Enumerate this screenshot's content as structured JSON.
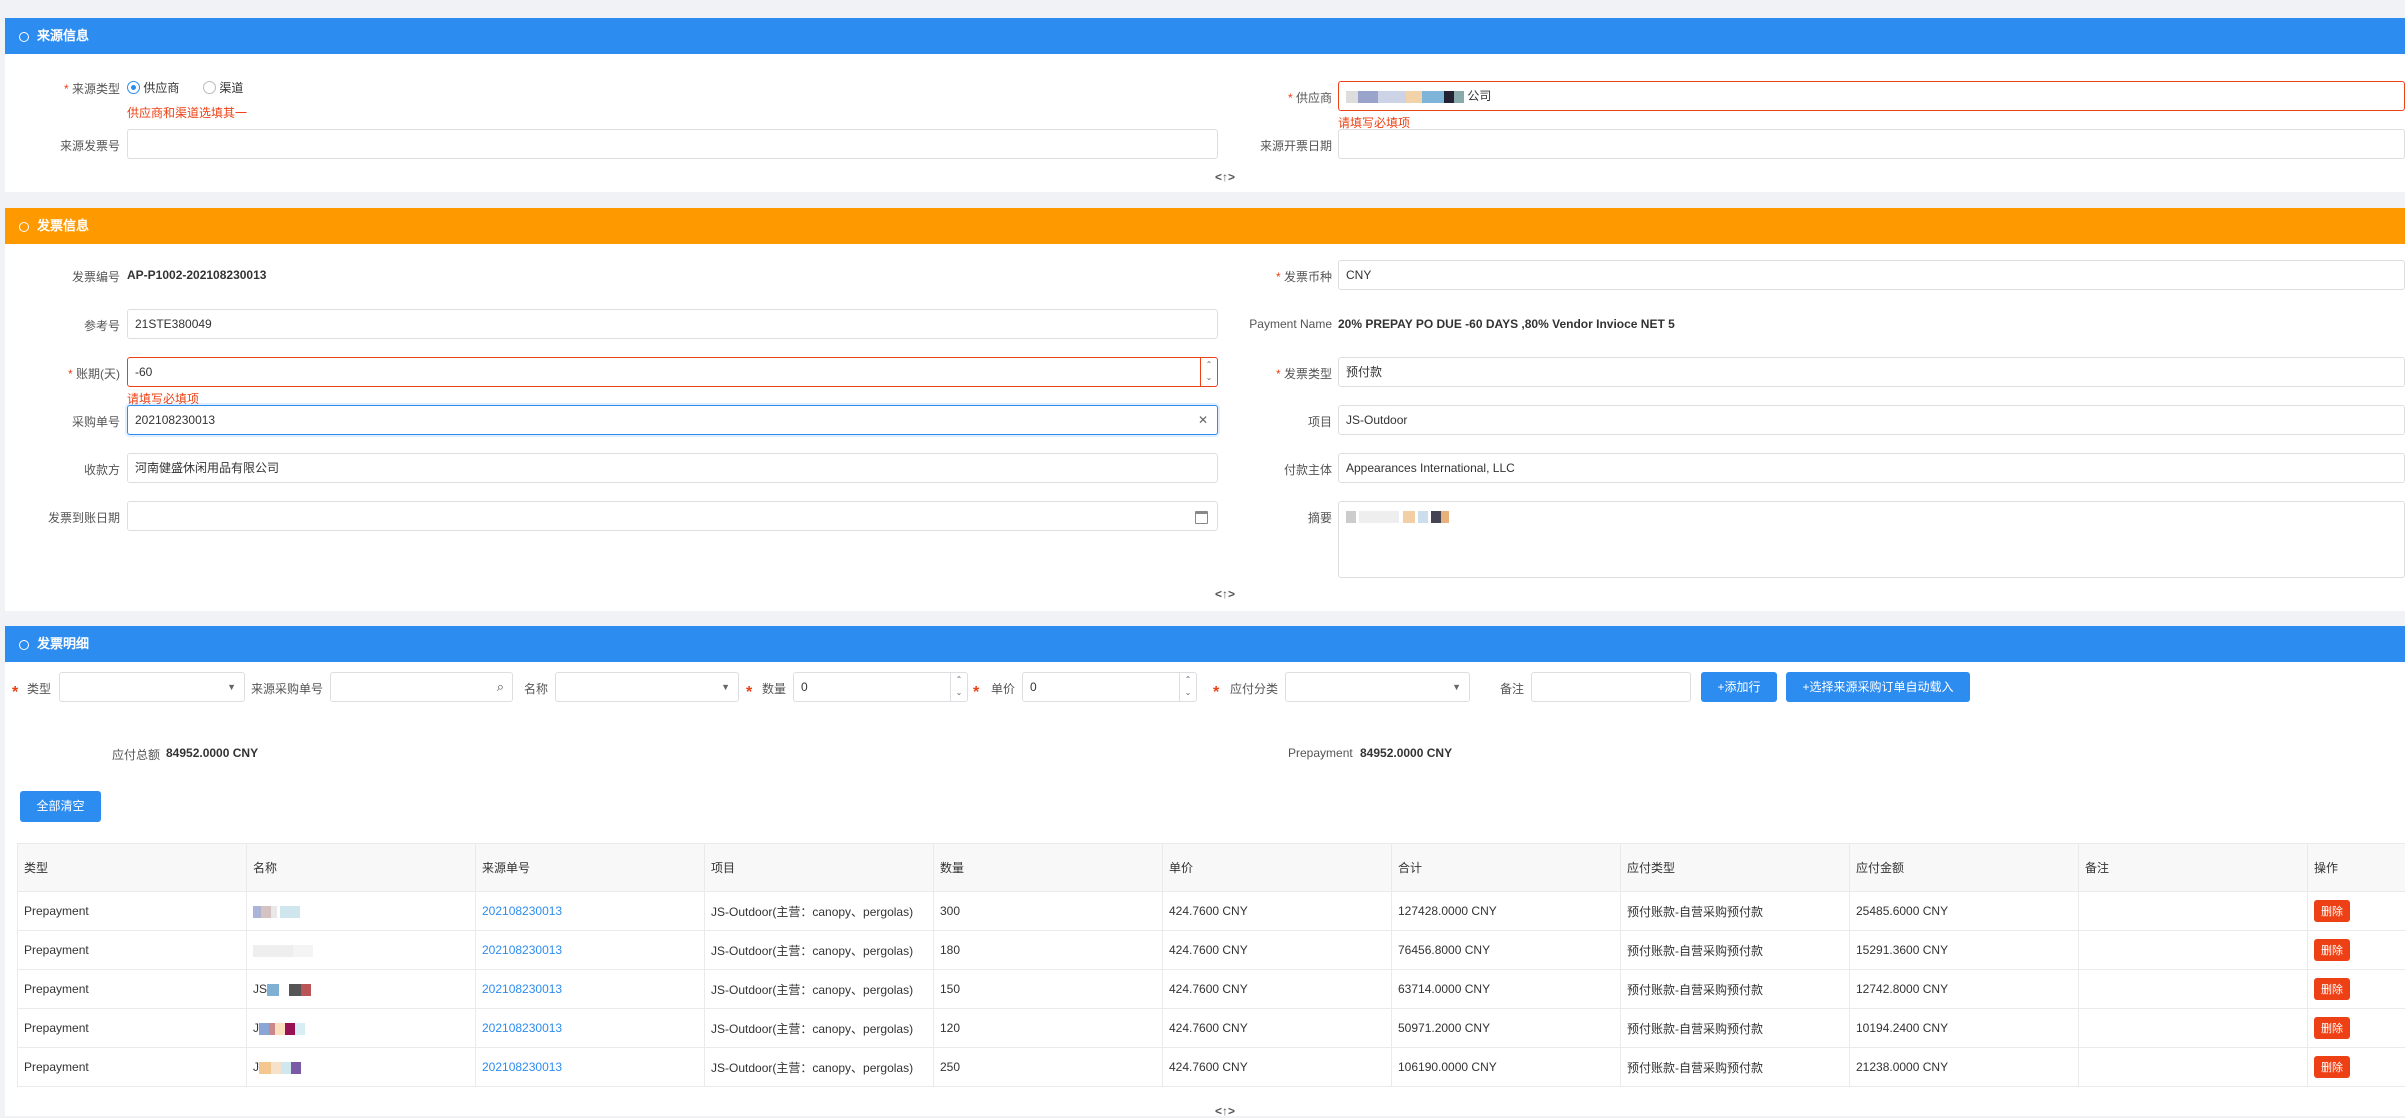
{
  "colors": {
    "primary": "#2d8cf0",
    "warning_bar": "#ff9900",
    "error": "#ed4014"
  },
  "source_section": {
    "title": "来源信息",
    "source_type_label": "来源类型",
    "radio_supplier": "供应商",
    "radio_channel": "渠道",
    "source_type_error": "供应商和渠道选填其一",
    "supplier_label": "供应商",
    "supplier_value_suffix": "公司",
    "supplier_error": "请填写必填项",
    "source_invoice_no_label": "来源发票号",
    "source_invoice_no_value": "",
    "source_invoice_date_label": "来源开票日期",
    "source_invoice_date_value": "",
    "collapse_icon": "collapse-toggle-icon",
    "collapse_text": "<↑>"
  },
  "invoice_section": {
    "title": "发票信息",
    "invoice_no_label": "发票编号",
    "invoice_no_value": "AP-P1002-202108230013",
    "currency_label": "发票币种",
    "currency_value": "CNY",
    "ref_no_label": "参考号",
    "ref_no_value": "21STE380049",
    "payment_name_label": "Payment Name",
    "payment_name_value": "20% PREPAY PO DUE -60 DAYS ,80% Vendor Invioce NET 5",
    "term_days_label": "账期(天)",
    "term_days_value": "-60",
    "term_days_error": "请填写必填项",
    "invoice_type_label": "发票类型",
    "invoice_type_value": "预付款",
    "po_no_label": "采购单号",
    "po_no_value": "202108230013",
    "project_label": "项目",
    "project_value": "JS-Outdoor",
    "payee_label": "收款方",
    "payee_value": "河南健盛休闲用品有限公司",
    "payer_label": "付款主体",
    "payer_value": "Appearances International, LLC",
    "arrival_date_label": "发票到账日期",
    "arrival_date_value": "",
    "summary_label": "摘要",
    "collapse_text": "<↑>"
  },
  "detail_section": {
    "title": "发票明细",
    "type_label": "类型",
    "source_po_label": "来源采购单号",
    "name_label": "名称",
    "qty_label": "数量",
    "qty_value": "0",
    "price_label": "单价",
    "price_value": "0",
    "ap_category_label": "应付分类",
    "remark_label": "备注",
    "add_row_button": "+添加行",
    "auto_load_button": "+选择来源采购订单自动载入",
    "total_label": "应付总额",
    "total_value": "84952.0000 CNY",
    "prepay_label": "Prepayment",
    "prepay_value": "84952.0000 CNY",
    "clear_all_button": "全部清空",
    "collapse_text": "<↑>"
  },
  "table": {
    "columns": [
      "类型",
      "名称",
      "来源单号",
      "项目",
      "数量",
      "单价",
      "合计",
      "应付类型",
      "应付金额",
      "备注",
      "操作"
    ],
    "rows": [
      {
        "type": "Prepayment",
        "name": "",
        "src": "202108230013",
        "project": "JS-Outdoor(主营：canopy、pergolas)",
        "qty": "300",
        "price": "424.7600 CNY",
        "total": "127428.0000 CNY",
        "ap_type": "预付账款-自营采购预付款",
        "amount": "25485.6000 CNY",
        "remark": "",
        "op": "删除"
      },
      {
        "type": "Prepayment",
        "name": "",
        "src": "202108230013",
        "project": "JS-Outdoor(主营：canopy、pergolas)",
        "qty": "180",
        "price": "424.7600 CNY",
        "total": "76456.8000 CNY",
        "ap_type": "预付账款-自营采购预付款",
        "amount": "15291.3600 CNY",
        "remark": "",
        "op": "删除"
      },
      {
        "type": "Prepayment",
        "name": "JS",
        "src": "202108230013",
        "project": "JS-Outdoor(主营：canopy、pergolas)",
        "qty": "150",
        "price": "424.7600 CNY",
        "total": "63714.0000 CNY",
        "ap_type": "预付账款-自营采购预付款",
        "amount": "12742.8000 CNY",
        "remark": "",
        "op": "删除"
      },
      {
        "type": "Prepayment",
        "name": "J",
        "src": "202108230013",
        "project": "JS-Outdoor(主营：canopy、pergolas)",
        "qty": "120",
        "price": "424.7600 CNY",
        "total": "50971.2000 CNY",
        "ap_type": "预付账款-自营采购预付款",
        "amount": "10194.2400 CNY",
        "remark": "",
        "op": "删除"
      },
      {
        "type": "Prepayment",
        "name": "J",
        "src": "202108230013",
        "project": "JS-Outdoor(主营：canopy、pergolas)",
        "qty": "250",
        "price": "424.7600 CNY",
        "total": "106190.0000 CNY",
        "ap_type": "预付账款-自营采购预付款",
        "amount": "21238.0000 CNY",
        "remark": "",
        "op": "删除"
      }
    ]
  }
}
